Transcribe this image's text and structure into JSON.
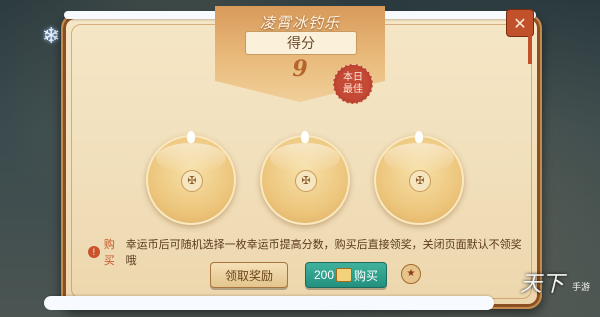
{
  "window": {
    "title": "凌霄冰钓乐"
  },
  "score": {
    "label": "得分",
    "value": "9",
    "best_badge": "本日最佳"
  },
  "cups": [
    {
      "emblem": "✠"
    },
    {
      "emblem": "✠"
    },
    {
      "emblem": "✠"
    }
  ],
  "notice": {
    "highlight": "购买",
    "text": "幸运币后可随机选择一枚幸运币提高分数，购买后直接领奖，关闭页面默认不领奖哦"
  },
  "buttons": {
    "claim": "领取奖励",
    "buy_price": "200",
    "buy_label": "购买"
  },
  "close": {
    "glyph": "✕"
  },
  "snowflake": {
    "glyph": "❄"
  },
  "medal": {
    "glyph": "★"
  },
  "brand": {
    "logo": "天下",
    "sub": "手游"
  },
  "colors": {
    "accent": "#c9542b",
    "buy_button": "#23907e",
    "panel": "#f1dfbb"
  }
}
